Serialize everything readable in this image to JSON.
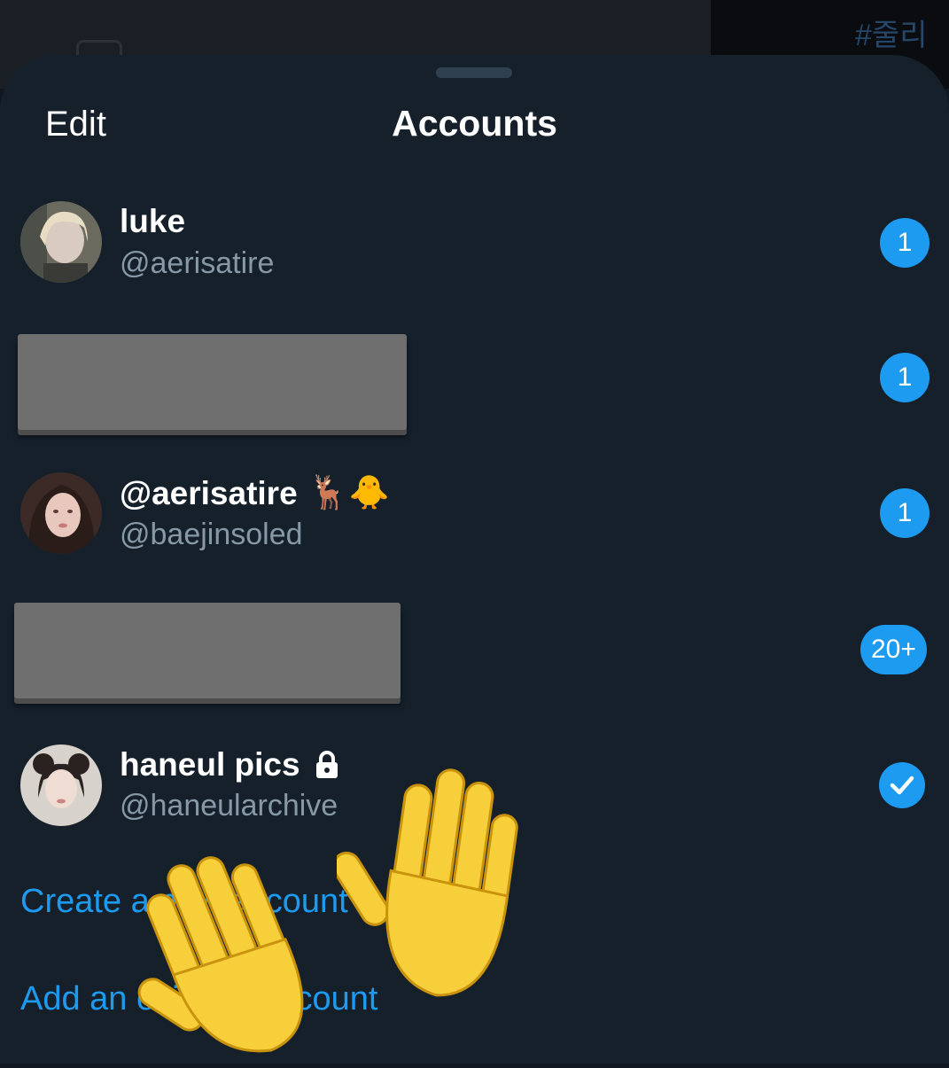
{
  "background": {
    "hashtag": "#줄리"
  },
  "sheet": {
    "edit_label": "Edit",
    "title": "Accounts"
  },
  "accounts": [
    {
      "name": "luke",
      "handle": "@aerisatire",
      "badge": "1"
    },
    {
      "name": "",
      "handle": "",
      "badge": "1",
      "redacted": true
    },
    {
      "name": "@aerisatire",
      "name_emoji": "🦌🐥",
      "handle": "@baejinsoled",
      "badge": "1"
    },
    {
      "name": "",
      "handle": "",
      "badge": "20+",
      "redacted": true
    },
    {
      "name": "haneul pics",
      "handle": "@haneularchive",
      "protected": true,
      "active": true
    }
  ],
  "actions": {
    "create_account": "Create a new account",
    "add_existing": "Add an existing account"
  },
  "stickers": [
    "waving-hand",
    "waving-hand"
  ],
  "colors": {
    "accent": "#1d9bf0",
    "sheet_bg": "#15202b",
    "muted_text": "#8899a6"
  }
}
